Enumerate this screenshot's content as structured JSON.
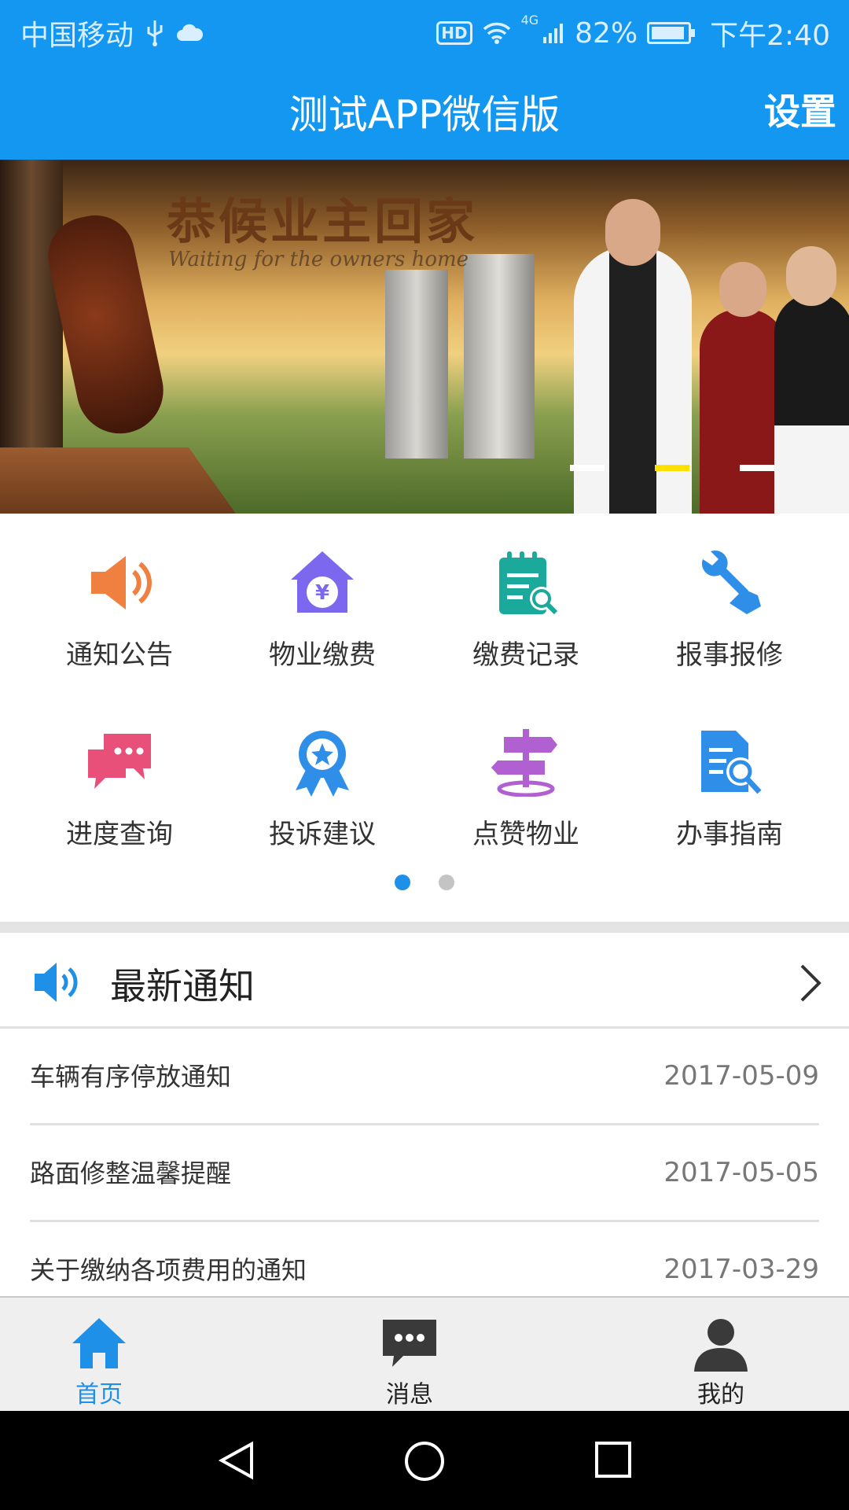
{
  "status_bar": {
    "carrier": "中国移动",
    "network": "4G",
    "hd": "HD",
    "battery_percent": "82%",
    "battery_level": 0.82,
    "time": "下午2:40",
    "icons": [
      "usb-icon",
      "cloud-icon",
      "wifi-icon",
      "signal-icon",
      "battery-icon"
    ]
  },
  "header": {
    "title": "测试APP微信版",
    "settings_label": "设置"
  },
  "banner": {
    "headline": "恭候业主回家",
    "subtitle": "Waiting for the owners home",
    "slide_count": 3,
    "active_slide": 2
  },
  "grid": {
    "items": [
      {
        "label": "通知公告",
        "icon": "speaker-icon",
        "color": "#f08040"
      },
      {
        "label": "物业缴费",
        "icon": "house-yen-icon",
        "color": "#7b68ee"
      },
      {
        "label": "缴费记录",
        "icon": "notepad-search-icon",
        "color": "#1aa99a"
      },
      {
        "label": "报事报修",
        "icon": "wrench-hand-icon",
        "color": "#2f8fe8"
      },
      {
        "label": "进度查询",
        "icon": "chat-bubbles-icon",
        "color": "#e8507a"
      },
      {
        "label": "投诉建议",
        "icon": "star-badge-icon",
        "color": "#2f8fe8"
      },
      {
        "label": "点赞物业",
        "icon": "signpost-icon",
        "color": "#b060d0"
      },
      {
        "label": "办事指南",
        "icon": "document-search-icon",
        "color": "#2f8fe8"
      }
    ],
    "page_count": 2,
    "active_page": 1
  },
  "notices": {
    "title": "最新通知",
    "items": [
      {
        "title": "车辆有序停放通知",
        "date": "2017-05-09"
      },
      {
        "title": "路面修整温馨提醒",
        "date": "2017-05-05"
      },
      {
        "title": "关于缴纳各项费用的通知",
        "date": "2017-03-29"
      }
    ]
  },
  "tabbar": {
    "tabs": [
      {
        "label": "首页",
        "icon": "home-icon",
        "active": true
      },
      {
        "label": "消息",
        "icon": "message-icon",
        "active": false
      },
      {
        "label": "我的",
        "icon": "person-icon",
        "active": false
      }
    ]
  },
  "colors": {
    "primary": "#1497f0",
    "accent": "#1e90e8",
    "indicator_active": "#ffe000"
  }
}
